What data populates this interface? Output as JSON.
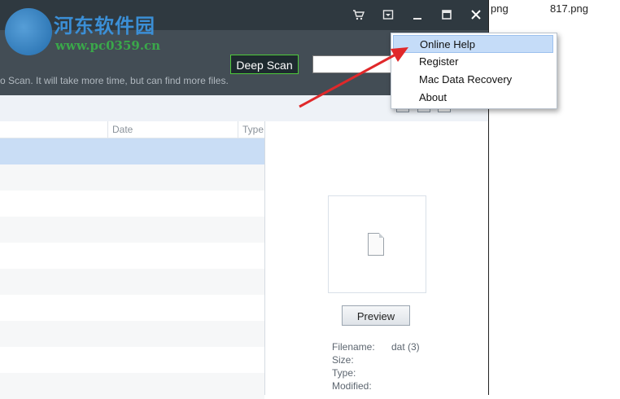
{
  "desktop": {
    "file1": "png",
    "file2": "817.png"
  },
  "watermark": {
    "title": "河东软件园",
    "url": "www.pc0359.cn"
  },
  "titlebar": {
    "icons": [
      "cart-icon",
      "dropdown-icon",
      "minimize-icon",
      "maximize-icon",
      "close-icon"
    ]
  },
  "toolbar": {
    "deep_scan_label": "Deep Scan",
    "search_value": "",
    "hint_text": "o Scan. It will take more time, but can find more files."
  },
  "list": {
    "columns": [
      "Date",
      "Type"
    ],
    "rows": 10
  },
  "preview": {
    "button_label": "Preview",
    "fields": [
      {
        "label": "Filename:",
        "value": "dat (3)"
      },
      {
        "label": "Size:",
        "value": ""
      },
      {
        "label": "Type:",
        "value": ""
      },
      {
        "label": "Modified:",
        "value": ""
      }
    ]
  },
  "menu": {
    "items": [
      "Online Help",
      "Register",
      "Mac Data Recovery",
      "About"
    ],
    "highlighted": "Online Help"
  },
  "colors": {
    "accent": "#4ecb3a",
    "arrow": "#e0282a",
    "highlight": "#c5dcf8"
  }
}
